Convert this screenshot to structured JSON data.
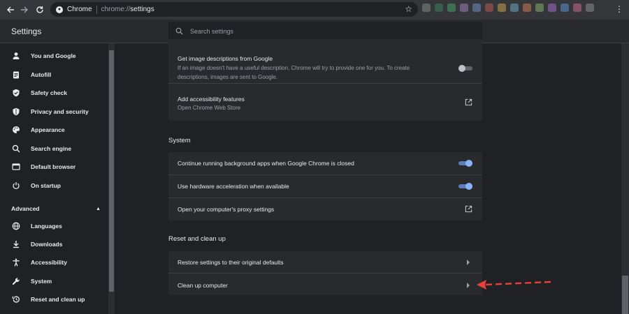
{
  "browser": {
    "site_chip": "Chrome",
    "url_scheme": "chrome://",
    "url_path": "settings",
    "icons": [
      "back-arrow-icon",
      "forward-arrow-icon",
      "reload-icon",
      "star-icon",
      "more-vert-icon"
    ],
    "extension_colors": [
      "#7b8a7e",
      "#3b7d57",
      "#46a36a",
      "#9a7bb8",
      "#6e8cc2",
      "#b75a5a",
      "#c9a14a",
      "#6aa5b8",
      "#d07a55",
      "#7fae6a",
      "#a06ac8",
      "#5a8fd0",
      "#c86a8a",
      "#8a8a8a"
    ]
  },
  "header": {
    "title": "Settings",
    "search_placeholder": "Search settings"
  },
  "sidebar": {
    "items": [
      {
        "label": "You and Google",
        "icon": "person-icon"
      },
      {
        "label": "Autofill",
        "icon": "clipboard-icon"
      },
      {
        "label": "Safety check",
        "icon": "shield-check-icon"
      },
      {
        "label": "Privacy and security",
        "icon": "shield-icon"
      },
      {
        "label": "Appearance",
        "icon": "palette-icon"
      },
      {
        "label": "Search engine",
        "icon": "search-icon"
      },
      {
        "label": "Default browser",
        "icon": "browser-window-icon"
      },
      {
        "label": "On startup",
        "icon": "power-icon"
      }
    ],
    "advanced_label": "Advanced",
    "advanced_items": [
      {
        "label": "Languages",
        "icon": "globe-icon"
      },
      {
        "label": "Downloads",
        "icon": "download-icon"
      },
      {
        "label": "Accessibility",
        "icon": "accessibility-icon"
      },
      {
        "label": "System",
        "icon": "wrench-icon"
      },
      {
        "label": "Reset and clean up",
        "icon": "history-icon"
      }
    ]
  },
  "accessibility_card": {
    "image_desc_title": "Get image descriptions from Google",
    "image_desc_sub_1": "If an image doesn't have a useful description, Chrome will try to provide one for you. To create",
    "image_desc_sub_2": "descriptions, images are sent to Google.",
    "image_desc_enabled": false,
    "add_features_title": "Add accessibility features",
    "add_features_sub": "Open Chrome Web Store"
  },
  "system": {
    "title": "System",
    "rows": [
      {
        "label": "Continue running background apps when Google Chrome is closed",
        "enabled": true
      },
      {
        "label": "Use hardware acceleration when available",
        "enabled": true
      },
      {
        "label": "Open your computer's proxy settings"
      }
    ]
  },
  "reset": {
    "title": "Reset and clean up",
    "rows": [
      {
        "label": "Restore settings to their original defaults"
      },
      {
        "label": "Clean up computer"
      }
    ]
  },
  "colors": {
    "accent": "#8ab4f8",
    "annotation_arrow": "#e8413c",
    "background": "#202124",
    "card": "#292a2d"
  }
}
